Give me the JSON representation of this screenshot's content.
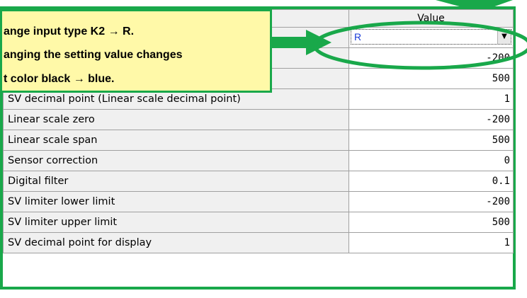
{
  "callout": {
    "line1": "ange input type K2 → R.",
    "line2": "anging the setting value changes",
    "line3": "t color black → blue."
  },
  "grid": {
    "value_header": "Value",
    "first_value": "R",
    "rows": [
      {
        "label": "",
        "value": "-200"
      },
      {
        "label": "",
        "value": "500"
      },
      {
        "label": "SV decimal point (Linear scale decimal point)",
        "value": "1"
      },
      {
        "label": "Linear scale zero",
        "value": "-200"
      },
      {
        "label": "Linear scale span",
        "value": "500"
      },
      {
        "label": "Sensor correction",
        "value": "0"
      },
      {
        "label": "Digital filter",
        "value": "0.1"
      },
      {
        "label": "SV limiter lower limit",
        "value": "-200"
      },
      {
        "label": "SV limiter upper limit",
        "value": "500"
      },
      {
        "label": "SV decimal point for display",
        "value": "1"
      }
    ]
  },
  "colors": {
    "highlight_green": "#19a84a",
    "callout_fill": "#fff9a8",
    "value_blue": "#1a3cd8"
  },
  "icons": {
    "dropdown": "chevron-down-icon",
    "arrow": "right-arrow-icon"
  }
}
